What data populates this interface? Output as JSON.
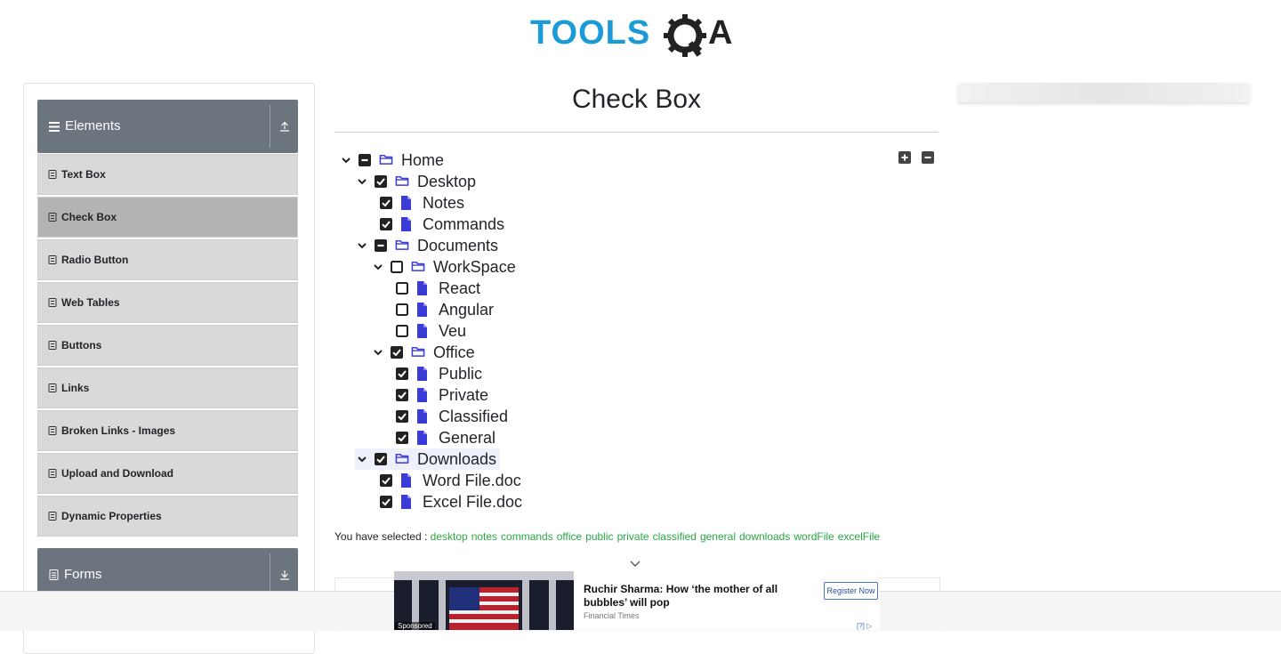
{
  "header": {
    "logo_text": "TOOLSQA"
  },
  "sidebar": {
    "groups": [
      {
        "label": "Elements",
        "expanded": true
      },
      {
        "label": "Forms",
        "expanded": false
      }
    ],
    "items": [
      {
        "label": "Text Box",
        "active": false
      },
      {
        "label": "Check Box",
        "active": true
      },
      {
        "label": "Radio Button",
        "active": false
      },
      {
        "label": "Web Tables",
        "active": false
      },
      {
        "label": "Buttons",
        "active": false
      },
      {
        "label": "Links",
        "active": false
      },
      {
        "label": "Broken Links - Images",
        "active": false
      },
      {
        "label": "Upload and Download",
        "active": false
      },
      {
        "label": "Dynamic Properties",
        "active": false
      }
    ]
  },
  "main": {
    "title": "Check Box",
    "tree": [
      {
        "label": "Home",
        "type": "folder",
        "state": "partial",
        "expanded": true
      },
      {
        "label": "Desktop",
        "type": "folder",
        "state": "checked",
        "expanded": true
      },
      {
        "label": "Notes",
        "type": "file",
        "state": "checked"
      },
      {
        "label": "Commands",
        "type": "file",
        "state": "checked"
      },
      {
        "label": "Documents",
        "type": "folder",
        "state": "partial",
        "expanded": true
      },
      {
        "label": "WorkSpace",
        "type": "folder",
        "state": "unchecked",
        "expanded": true
      },
      {
        "label": "React",
        "type": "file",
        "state": "unchecked"
      },
      {
        "label": "Angular",
        "type": "file",
        "state": "unchecked"
      },
      {
        "label": "Veu",
        "type": "file",
        "state": "unchecked"
      },
      {
        "label": "Office",
        "type": "folder",
        "state": "checked",
        "expanded": true
      },
      {
        "label": "Public",
        "type": "file",
        "state": "checked"
      },
      {
        "label": "Private",
        "type": "file",
        "state": "checked"
      },
      {
        "label": "Classified",
        "type": "file",
        "state": "checked"
      },
      {
        "label": "General",
        "type": "file",
        "state": "checked"
      },
      {
        "label": "Downloads",
        "type": "folder",
        "state": "checked",
        "expanded": true,
        "highlighted": true
      },
      {
        "label": "Word File.doc",
        "type": "file",
        "state": "checked"
      },
      {
        "label": "Excel File.doc",
        "type": "file",
        "state": "checked"
      }
    ],
    "result_label": "You have selected :",
    "selected": [
      "desktop",
      "notes",
      "commands",
      "office",
      "public",
      "private",
      "classified",
      "general",
      "downloads",
      "wordFile",
      "excelFile"
    ]
  },
  "ad": {
    "sponsored": "Sponsored",
    "headline": "Ruchir Sharma: How ‘the mother of all bubbles’ will pop",
    "source": "Financial Times",
    "cta": "Register Now",
    "choices": "[?]"
  },
  "colors": {
    "sidebar_header": "#6c757d",
    "menu_item": "#d9d9d9",
    "menu_item_active": "#b3b3b3",
    "tree_icon": "#3b3bd8",
    "selected_text": "#28a745",
    "logo_blue": "#1a9ad6"
  }
}
